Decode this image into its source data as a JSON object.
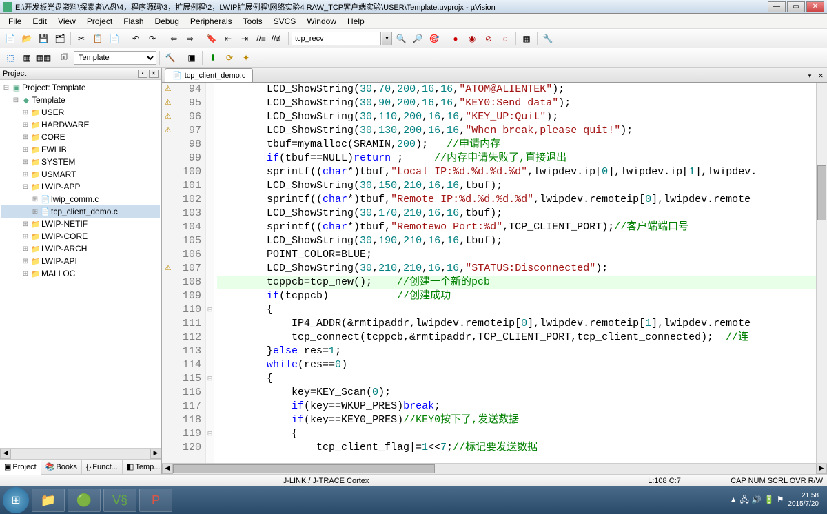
{
  "title": "E:\\开发板光盘资料\\探索者\\A盘\\4，程序源码\\3，扩展例程\\2，LWIP扩展例程\\网络实验4 RAW_TCP客户端实验\\USER\\Template.uvprojx - µVision",
  "menu": [
    "File",
    "Edit",
    "View",
    "Project",
    "Flash",
    "Debug",
    "Peripherals",
    "Tools",
    "SVCS",
    "Window",
    "Help"
  ],
  "search_value": "tcp_recv",
  "config_select": "Template",
  "project_panel_title": "Project",
  "tree": {
    "root": "Project: Template",
    "target": "Template",
    "groups": [
      "USER",
      "HARDWARE",
      "CORE",
      "FWLIB",
      "SYSTEM",
      "USMART",
      "LWIP-APP",
      "LWIP-NETIF",
      "LWIP-CORE",
      "LWIP-ARCH",
      "LWIP-API",
      "MALLOC"
    ],
    "lwip_app_files": [
      "lwip_comm.c",
      "tcp_client_demo.c"
    ]
  },
  "proj_bottom_tabs": [
    "Project",
    "Books",
    "Funct...",
    "Temp..."
  ],
  "editor_tab": "tcp_client_demo.c",
  "lines": [
    {
      "n": 94,
      "m": "⚠",
      "c": "        LCD_ShowString(<n>30</n>,<n>70</n>,<n>200</n>,<n>16</n>,<n>16</n>,<s>\"ATOM@ALIENTEK\"</s>);"
    },
    {
      "n": 95,
      "m": "⚠",
      "c": "        LCD_ShowString(<n>30</n>,<n>90</n>,<n>200</n>,<n>16</n>,<n>16</n>,<s>\"KEY0:Send data\"</s>);"
    },
    {
      "n": 96,
      "m": "⚠",
      "c": "        LCD_ShowString(<n>30</n>,<n>110</n>,<n>200</n>,<n>16</n>,<n>16</n>,<s>\"KEY_UP:Quit\"</s>);"
    },
    {
      "n": 97,
      "m": "⚠",
      "c": "        LCD_ShowString(<n>30</n>,<n>130</n>,<n>200</n>,<n>16</n>,<n>16</n>,<s>\"When break,please quit!\"</s>);"
    },
    {
      "n": 98,
      "m": "",
      "c": "        tbuf=mymalloc(SRAMIN,<n>200</n>);   <g>//申请内存</g>"
    },
    {
      "n": 99,
      "m": "",
      "c": "        <k>if</k>(tbuf==NULL)<k>return</k> ;     <g>//内存申请失败了,直接退出</g>"
    },
    {
      "n": 100,
      "m": "",
      "c": "        sprintf((<k>char</k>*)tbuf,<s>\"Local IP:%d.%d.%d.%d\"</s>,lwipdev.ip[<n>0</n>],lwipdev.ip[<n>1</n>],lwipdev."
    },
    {
      "n": 101,
      "m": "",
      "c": "        LCD_ShowString(<n>30</n>,<n>150</n>,<n>210</n>,<n>16</n>,<n>16</n>,tbuf);"
    },
    {
      "n": 102,
      "m": "",
      "c": "        sprintf((<k>char</k>*)tbuf,<s>\"Remote IP:%d.%d.%d.%d\"</s>,lwipdev.remoteip[<n>0</n>],lwipdev.remote"
    },
    {
      "n": 103,
      "m": "",
      "c": "        LCD_ShowString(<n>30</n>,<n>170</n>,<n>210</n>,<n>16</n>,<n>16</n>,tbuf);"
    },
    {
      "n": 104,
      "m": "",
      "c": "        sprintf((<k>char</k>*)tbuf,<s>\"Remotewo Port:%d\"</s>,TCP_CLIENT_PORT);<g>//客户端端口号</g>"
    },
    {
      "n": 105,
      "m": "",
      "c": "        LCD_ShowString(<n>30</n>,<n>190</n>,<n>210</n>,<n>16</n>,<n>16</n>,tbuf);"
    },
    {
      "n": 106,
      "m": "",
      "c": "        POINT_COLOR=BLUE;"
    },
    {
      "n": 107,
      "m": "⚠",
      "c": "        LCD_ShowString(<n>30</n>,<n>210</n>,<n>210</n>,<n>16</n>,<n>16</n>,<s>\"STATUS:Disconnected\"</s>);"
    },
    {
      "n": 108,
      "m": "",
      "hl": true,
      "c": "        tcppcb=tcp_new();    <g>//创建一个新的pcb</g>"
    },
    {
      "n": 109,
      "m": "",
      "c": "        <k>if</k>(tcppcb)           <g>//创建成功</g>"
    },
    {
      "n": 110,
      "m": "",
      "f": "⊟",
      "c": "        {"
    },
    {
      "n": 111,
      "m": "",
      "c": "            IP4_ADDR(&rmtipaddr,lwipdev.remoteip[<n>0</n>],lwipdev.remoteip[<n>1</n>],lwipdev.remote"
    },
    {
      "n": 112,
      "m": "",
      "c": "            tcp_connect(tcppcb,&rmtipaddr,TCP_CLIENT_PORT,tcp_client_connected);  <g>//连</g>"
    },
    {
      "n": 113,
      "m": "",
      "c": "        }<k>else</k> res=<n>1</n>;"
    },
    {
      "n": 114,
      "m": "",
      "c": "        <k>while</k>(res==<n>0</n>)"
    },
    {
      "n": 115,
      "m": "",
      "f": "⊟",
      "c": "        {"
    },
    {
      "n": 116,
      "m": "",
      "c": "            key=KEY_Scan(<n>0</n>);"
    },
    {
      "n": 117,
      "m": "",
      "c": "            <k>if</k>(key==WKUP_PRES)<k>break</k>;"
    },
    {
      "n": 118,
      "m": "",
      "c": "            <k>if</k>(key==KEY0_PRES)<g>//KEY0按下了,发送数据</g>"
    },
    {
      "n": 119,
      "m": "",
      "f": "⊟",
      "c": "            {"
    },
    {
      "n": 120,
      "m": "",
      "c": "                tcp_client_flag|=<n>1</n><<<n>7</n>;<g>//标记要发送数据</g>"
    }
  ],
  "status": {
    "debug": "J-LINK / J-TRACE Cortex",
    "pos": "L:108 C:7",
    "flags": "CAP  NUM  SCRL  OVR  R/W"
  },
  "clock": {
    "time": "21:58",
    "date": "2015/7/20"
  }
}
